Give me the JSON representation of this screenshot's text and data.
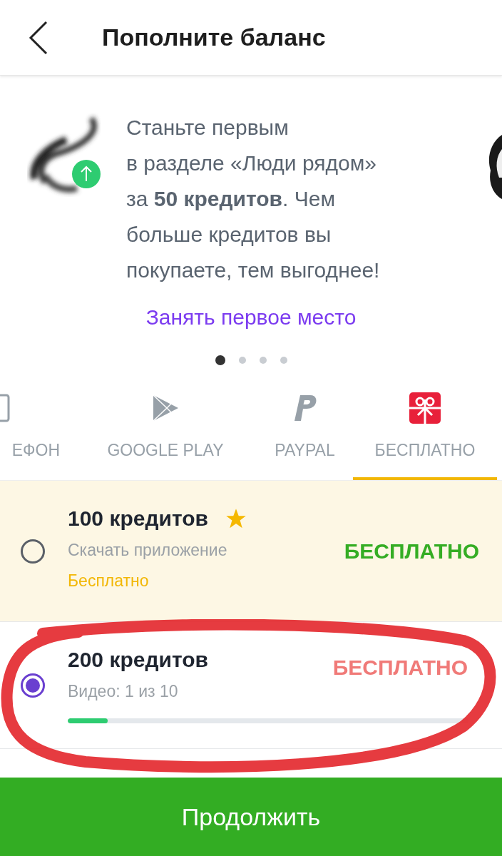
{
  "header": {
    "title": "Пополните баланс"
  },
  "banner": {
    "lines": [
      "Станьте первым",
      "в разделе «Люди рядом»",
      "за **50 кредитов**. Чем",
      "больше кредитов вы",
      "покупаете, тем выгоднее!"
    ],
    "link": "Занять первое место",
    "dots": [
      {
        "selected": true
      },
      {
        "selected": false
      },
      {
        "selected": false
      },
      {
        "selected": false
      }
    ]
  },
  "tabs": [
    {
      "label": "ЕФОН",
      "kind": "phone",
      "selected": false
    },
    {
      "label": "GOOGLE PLAY",
      "kind": "play",
      "selected": false
    },
    {
      "label": "PAYPAL",
      "kind": "paypal",
      "selected": false
    },
    {
      "label": "БЕСПЛАТНО",
      "kind": "gift",
      "selected": true
    }
  ],
  "offers": [
    {
      "kind": "download",
      "title": "100 кредитов",
      "featured": true,
      "subtitle": "Скачать приложение",
      "status": "Бесплатно",
      "price": "БЕСПЛАТНО",
      "selected": false
    },
    {
      "kind": "video",
      "title": "200 кредитов",
      "featured": false,
      "subtitle": "Видео: 1 из 10",
      "price": "БЕСПЛАТНО",
      "level": 0.1,
      "selected": true
    }
  ],
  "continue_button": "Продолжить"
}
